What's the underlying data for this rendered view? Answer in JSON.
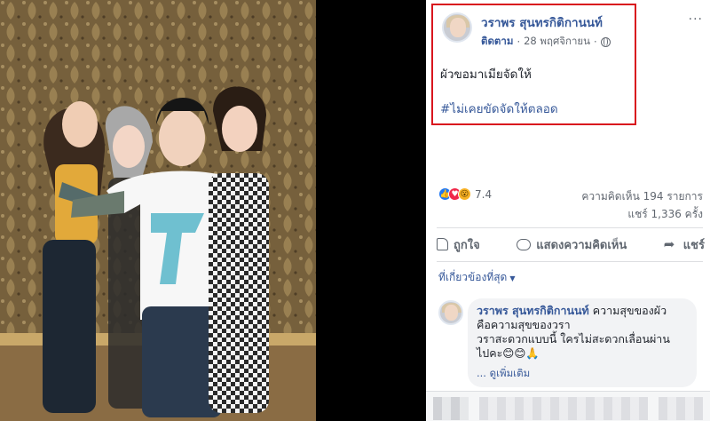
{
  "post": {
    "author": "วราพร สุนทรกิติกานนท์",
    "follow_label": "ติดตาม",
    "separator": "·",
    "date": "28 พฤศจิกายน",
    "more_label": "···",
    "text": "ผัวขอมาเมียจัดให้",
    "hashtag": "#ไม่เคยขัดจัดให้ตลอด"
  },
  "stats": {
    "reactions_count": "7.4",
    "comments": "ความคิดเห็น 194 รายการ",
    "shares": "แชร์ 1,336 ครั้ง"
  },
  "actions": {
    "like": "ถูกใจ",
    "comment": "แสดงความคิดเห็น",
    "share": "แชร์"
  },
  "comments_section": {
    "sort_label": "ที่เกี่ยวข้องที่สุด",
    "sort_caret": "▼",
    "comment": {
      "author": "วราพร สุนทรกิติกานนท์",
      "line1": "ความสุขของผัว",
      "line2": "คือความสุขของวรา",
      "line3": "วราสะดวกแบบนี้ ใครไม่สะดวกเลื่อนผ่าน",
      "line4": "ไปคะ😊😊🙏",
      "see_more": "... ดูเพิ่มเติม"
    }
  },
  "colors": {
    "link_blue": "#365899",
    "highlight_red": "#d9161e",
    "like_blue": "#2078f4",
    "love_red": "#f0284a",
    "wow_yellow": "#f7b125"
  }
}
